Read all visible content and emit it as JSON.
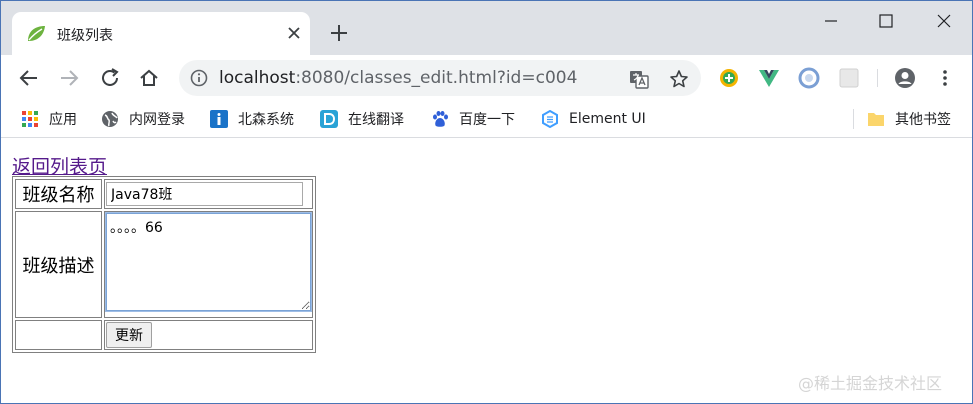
{
  "browser": {
    "tab": {
      "title": "班级列表"
    },
    "address_bar": {
      "host": "localhost",
      "path": ":8080/classes_edit.html?id=c004"
    },
    "bookmarks": [
      {
        "label": "应用",
        "icon": "apps-grid-icon"
      },
      {
        "label": "内网登录",
        "icon": "globe-icon"
      },
      {
        "label": "北森系统",
        "icon": "info-square-icon"
      },
      {
        "label": "在线翻译",
        "icon": "d-square-icon"
      },
      {
        "label": "百度一下",
        "icon": "paw-icon"
      },
      {
        "label": "Element UI",
        "icon": "element-hex-icon"
      }
    ],
    "other_bookmarks": "其他书签",
    "colors": {
      "tabstrip": "#dee1e6",
      "omnibox": "#f1f3f4",
      "link_visited": "#551a8b"
    }
  },
  "page": {
    "back_link": "返回列表页",
    "form": {
      "name_label": "班级名称",
      "name_value": "Java78班",
      "desc_label": "班级描述",
      "desc_value": "。。。。66",
      "update_button": "更新"
    },
    "watermark": "@稀土掘金技术社区"
  }
}
